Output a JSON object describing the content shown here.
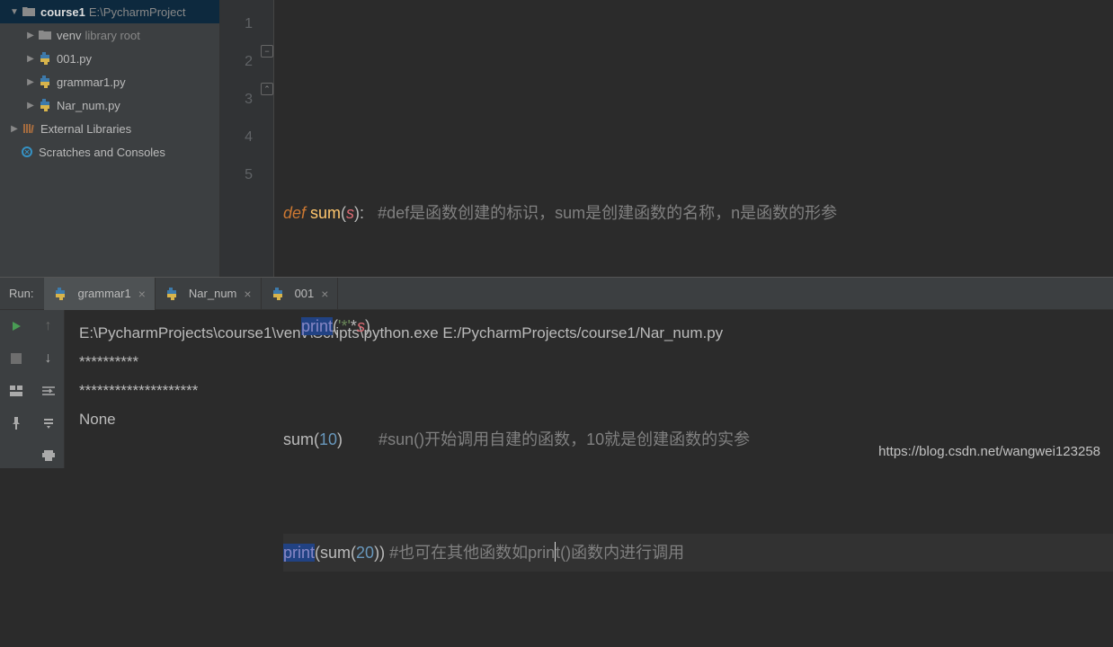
{
  "sidebar": {
    "project_name": "course1",
    "project_path": "E:\\PycharmProject",
    "venv_label": "venv",
    "venv_hint": "library root",
    "files": [
      "001.py",
      "grammar1.py",
      "Nar_num.py"
    ],
    "external_libs": "External Libraries",
    "scratches": "Scratches and Consoles"
  },
  "editor": {
    "line_numbers": [
      "1",
      "2",
      "3",
      "4",
      "5"
    ],
    "code_lines": {
      "l2_kw": "def ",
      "l2_fn": "sum",
      "l2_p1": "(",
      "l2_param": "s",
      "l2_p2": ")",
      "l2_colon": ":",
      "l2_cmt": "   #def是函数创建的标识，sum是创建函数的名称，n是函数的形参",
      "l3_print": "print",
      "l3_p1": "(",
      "l3_str": "'*'",
      "l3_star": "*",
      "l3_s": "s",
      "l3_p2": ")",
      "l4_fn": "sum",
      "l4_p1": "(",
      "l4_num": "10",
      "l4_p2": ")",
      "l4_cmt": "        #sun()开始调用自建的函数，10就是创建函数的实参",
      "l5_print": "print",
      "l5_p1": "(",
      "l5_sum": "sum",
      "l5_p2": "(",
      "l5_num": "20",
      "l5_p3": ")",
      "l5_p4": ")",
      "l5_cmt": " #也可在其他函数如prin",
      "l5_cmt2": "t()函数内进行调用"
    }
  },
  "run": {
    "label": "Run:",
    "tabs": [
      {
        "name": "grammar1",
        "active": true
      },
      {
        "name": "Nar_num",
        "active": false
      },
      {
        "name": "001",
        "active": false
      }
    ],
    "output": {
      "cmd": "E:\\PycharmProjects\\course1\\venv\\Scripts\\python.exe E:/PycharmProjects/course1/Nar_num.py",
      "line1": "**********",
      "line2": "********************",
      "line3": "None"
    }
  },
  "watermark": "https://blog.csdn.net/wangwei123258"
}
